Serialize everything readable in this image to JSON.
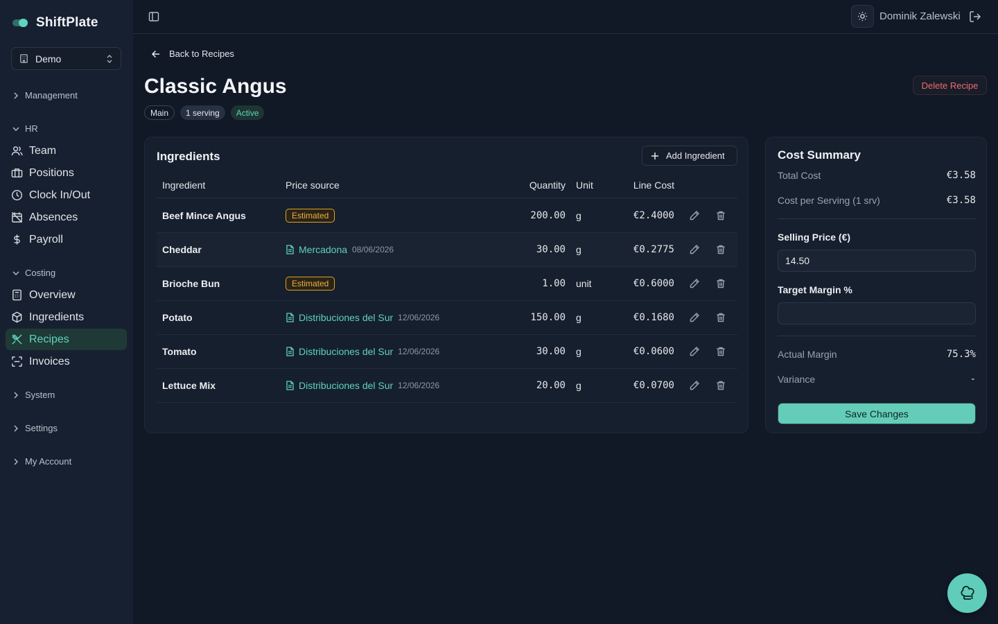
{
  "app": {
    "name": "ShiftPlate"
  },
  "org_selector": {
    "value": "Demo"
  },
  "sidebar": {
    "management": "Management",
    "hr": {
      "label": "HR",
      "items": [
        "Team",
        "Positions",
        "Clock In/Out",
        "Absences",
        "Payroll"
      ]
    },
    "costing": {
      "label": "Costing",
      "items": [
        "Overview",
        "Ingredients",
        "Recipes",
        "Invoices"
      ],
      "active": "Recipes"
    },
    "system": "System",
    "settings": "Settings",
    "account": "My Account"
  },
  "topbar": {
    "user": "Dominik Zalewski"
  },
  "page": {
    "back_label": "Back to Recipes",
    "title": "Classic Angus",
    "badges": [
      "Main",
      "1 serving",
      "Active"
    ],
    "delete_label": "Delete Recipe"
  },
  "ingredients": {
    "title": "Ingredients",
    "add_label": "Add Ingredient",
    "columns": [
      "Ingredient",
      "Price source",
      "Quantity",
      "Unit",
      "Line Cost"
    ],
    "rows": [
      {
        "name": "Beef Mince Angus",
        "source_type": "estimated",
        "source": "Estimated",
        "date": "",
        "qty": "200.00",
        "unit": "g",
        "cost": "€2.4000"
      },
      {
        "name": "Cheddar",
        "source_type": "invoice",
        "source": "Mercadona",
        "date": "08/06/2026",
        "qty": "30.00",
        "unit": "g",
        "cost": "€0.2775"
      },
      {
        "name": "Brioche Bun",
        "source_type": "estimated",
        "source": "Estimated",
        "date": "",
        "qty": "1.00",
        "unit": "unit",
        "cost": "€0.6000"
      },
      {
        "name": "Potato",
        "source_type": "invoice",
        "source": "Distribuciones del Sur",
        "date": "12/06/2026",
        "qty": "150.00",
        "unit": "g",
        "cost": "€0.1680"
      },
      {
        "name": "Tomato",
        "source_type": "invoice",
        "source": "Distribuciones del Sur",
        "date": "12/06/2026",
        "qty": "30.00",
        "unit": "g",
        "cost": "€0.0600"
      },
      {
        "name": "Lettuce Mix",
        "source_type": "invoice",
        "source": "Distribuciones del Sur",
        "date": "12/06/2026",
        "qty": "20.00",
        "unit": "g",
        "cost": "€0.0700"
      }
    ]
  },
  "cost_summary": {
    "title": "Cost Summary",
    "total_cost_label": "Total Cost",
    "total_cost": "€3.58",
    "per_serving_label": "Cost per Serving (1 srv)",
    "per_serving": "€3.58",
    "selling_price_label": "Selling Price (€)",
    "selling_price": "14.50",
    "target_margin_label": "Target Margin %",
    "target_margin": "",
    "actual_margin_label": "Actual Margin",
    "actual_margin": "75.3%",
    "variance_label": "Variance",
    "variance": "-",
    "save_label": "Save Changes"
  },
  "colors": {
    "accent": "#5fd3bf",
    "danger": "#f06b6b",
    "warning": "#f0b040",
    "background": "#111826",
    "sidebar": "#172030"
  }
}
